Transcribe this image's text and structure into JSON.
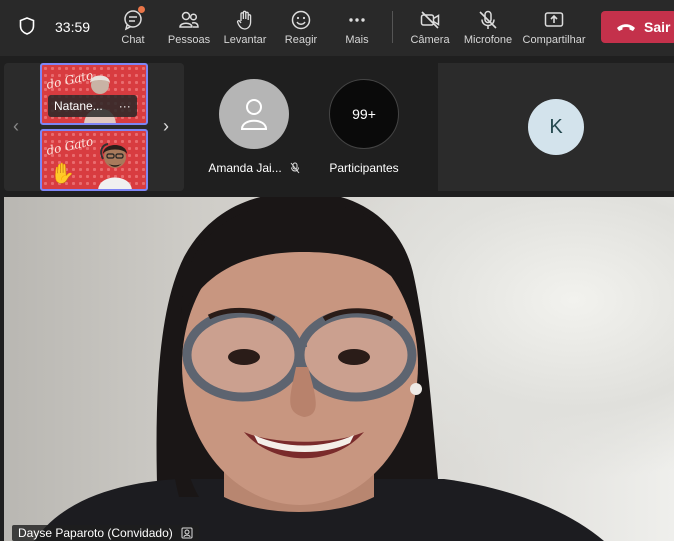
{
  "toolbar": {
    "timer": "33:59",
    "buttons": [
      {
        "label": "Chat",
        "icon": "chat-icon"
      },
      {
        "label": "Pessoas",
        "icon": "people-icon"
      },
      {
        "label": "Levantar",
        "icon": "raise-hand-icon"
      },
      {
        "label": "Reagir",
        "icon": "emoji-icon"
      },
      {
        "label": "Mais",
        "icon": "more-icon"
      },
      {
        "label": "Câmera",
        "icon": "camera-off-icon"
      },
      {
        "label": "Microfone",
        "icon": "mic-off-icon"
      },
      {
        "label": "Compartilhar",
        "icon": "share-icon"
      }
    ],
    "leave_label": "Sair",
    "leave_color": "#c4314b",
    "notification_color": "#e97548"
  },
  "gallery": {
    "thumbs": [
      {
        "name": "Natane...",
        "more": "···"
      },
      {
        "name": "",
        "hand": "✋"
      }
    ],
    "thumb_logo": "do Gato",
    "accent": "#7f85f5"
  },
  "tiles": {
    "amanda": {
      "name": "Amanda Jai..."
    },
    "participants": {
      "count": "99+",
      "label": "Participantes"
    },
    "k": {
      "initial": "K"
    }
  },
  "main_video": {
    "name": "Dayse Paparoto (Convidado)"
  }
}
